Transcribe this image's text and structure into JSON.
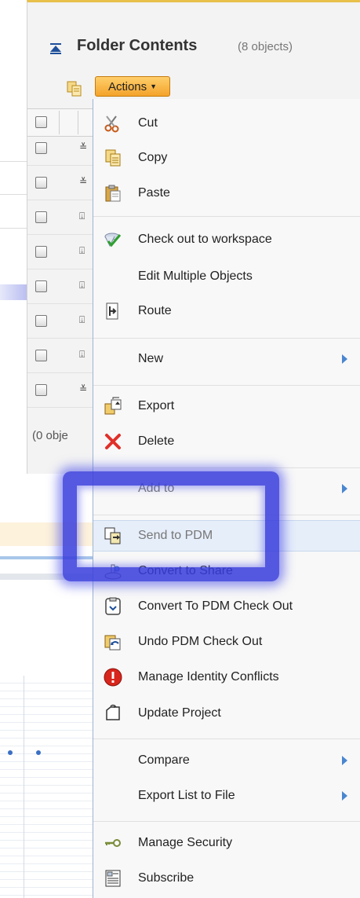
{
  "panel": {
    "title": "Folder Contents",
    "count": "(8 objects)",
    "footer": "(0 obje",
    "actions_label": "Actions",
    "row_icons": [
      "≚",
      "≚",
      "⍗",
      "⍗",
      "⍗",
      "⍗",
      "⍗",
      "≚"
    ]
  },
  "menu": {
    "items": [
      {
        "label": "Cut",
        "icon": "scissors-icon"
      },
      {
        "label": "Copy",
        "icon": "copy-icon"
      },
      {
        "label": "Paste",
        "icon": "paste-icon"
      },
      {
        "label": "Check out to workspace",
        "icon": "checkout-icon"
      },
      {
        "label": "Edit Multiple Objects",
        "icon": ""
      },
      {
        "label": "Route",
        "icon": "route-icon"
      },
      {
        "label": "New",
        "icon": "",
        "submenu": true
      },
      {
        "label": "Export",
        "icon": "export-icon"
      },
      {
        "label": "Delete",
        "icon": "delete-icon"
      },
      {
        "label": "Add to",
        "icon": "",
        "submenu": true
      },
      {
        "label": "Send to PDM",
        "icon": "send-to-pdm-icon"
      },
      {
        "label": "Convert to Share",
        "icon": "convert-share-icon"
      },
      {
        "label": "Convert To PDM Check Out",
        "icon": "pdm-checkout-icon"
      },
      {
        "label": "Undo PDM Check Out",
        "icon": "undo-checkout-icon"
      },
      {
        "label": "Manage Identity Conflicts",
        "icon": "alert-icon"
      },
      {
        "label": "Update Project",
        "icon": "update-project-icon"
      },
      {
        "label": "Compare",
        "icon": "",
        "submenu": true
      },
      {
        "label": "Export List to File",
        "icon": "",
        "submenu": true
      },
      {
        "label": "Manage Security",
        "icon": "key-icon"
      },
      {
        "label": "Subscribe",
        "icon": "subscribe-icon"
      }
    ]
  },
  "colors": {
    "actions_button": "#f3a32a",
    "highlight": "#3a3fdc",
    "submenu_arrow": "#4a86d0",
    "delete_red": "#e0302a"
  }
}
